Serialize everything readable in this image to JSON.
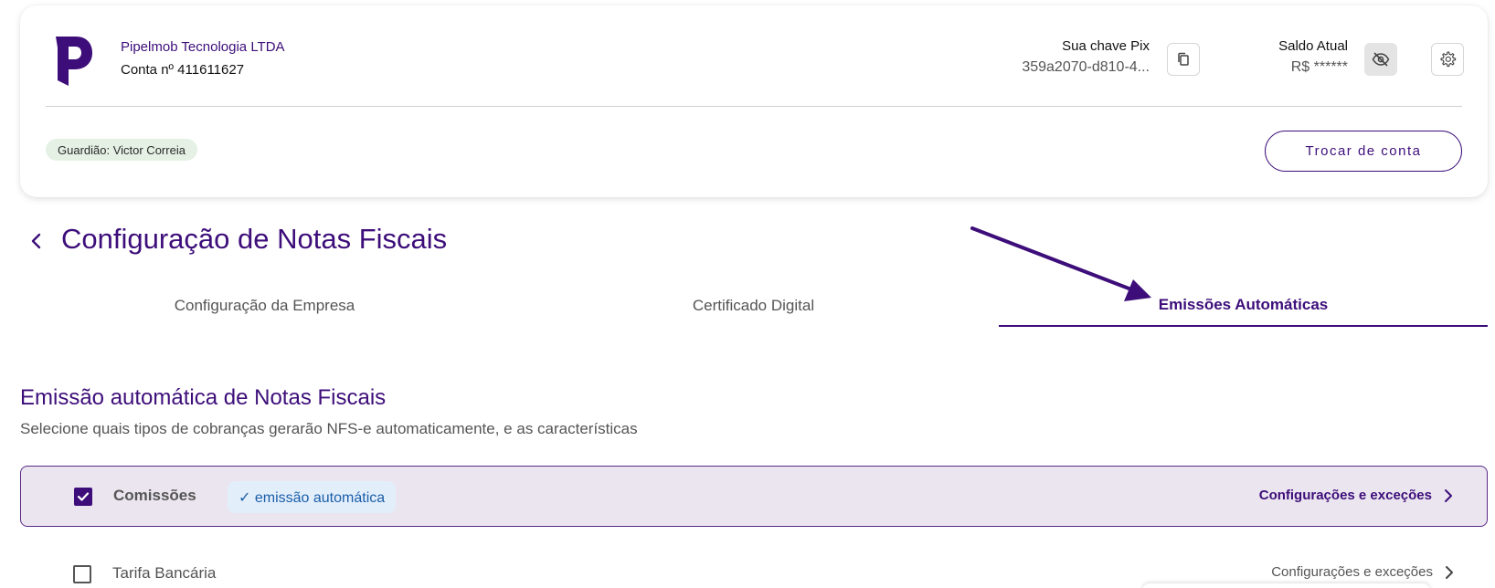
{
  "account": {
    "company_name": "Pipelmob Tecnologia LTDA",
    "account_number": "Conta nº 411611627",
    "pix_title": "Sua chave Pix",
    "pix_value": "359a2070-d810-4...",
    "balance_title": "Saldo Atual",
    "balance_value": "R$ ******",
    "guardian": "Guardião: Victor Correia",
    "switch_account": "Trocar de conta"
  },
  "page": {
    "title": "Configuração de Notas Fiscais"
  },
  "tabs": [
    {
      "label": "Configuração da Empresa",
      "active": false
    },
    {
      "label": "Certificado Digital",
      "active": false
    },
    {
      "label": "Emissões Automáticas",
      "active": true
    }
  ],
  "section": {
    "title": "Emissão automática de Notas Fiscais",
    "subtitle": "Selecione quais tipos de cobranças gerarão NFS-e automaticamente, e as características"
  },
  "rows": [
    {
      "label": "Comissões",
      "checked": true,
      "chip": "✓ emissão automática",
      "link": "Configurações e exceções"
    },
    {
      "label": "Tarifa Bancária",
      "checked": false,
      "link": "Configurações e exceções"
    }
  ],
  "colors": {
    "brand": "#3d0e7a",
    "selected_row_bg": "#ebe5ef",
    "chip_bg": "#e3eefb",
    "chip_text": "#1b5fa8",
    "guardian_chip_bg": "#e6f1e6"
  },
  "icons": {
    "logo": "pipelmob-logo",
    "copy": "copy-icon",
    "eye_off": "eye-off-icon",
    "gear": "gear-icon",
    "back": "chevron-left-icon",
    "chevron": "chevron-right-icon",
    "check": "check-icon"
  }
}
